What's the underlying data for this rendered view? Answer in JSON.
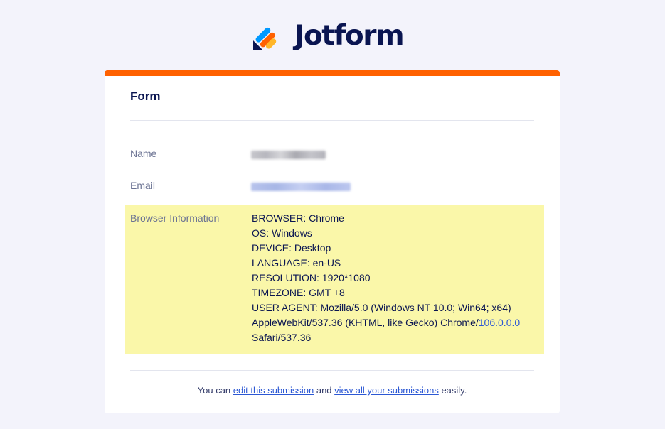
{
  "brand": {
    "name": "Jotform",
    "mark_colors": [
      "#0099ff",
      "#ff6100",
      "#ffb629",
      "#0a1551"
    ]
  },
  "form": {
    "title": "Form",
    "accent_color": "#ff6100",
    "fields": {
      "name_label": "Name",
      "email_label": "Email",
      "browser_label": "Browser Information"
    },
    "browser_info": {
      "browser": "BROWSER: Chrome",
      "os": "OS: Windows",
      "device": "DEVICE: Desktop",
      "language": "LANGUAGE: en-US",
      "resolution": "RESOLUTION: 1920*1080",
      "timezone": "TIMEZONE: GMT +8",
      "user_agent_1": "USER AGENT: Mozilla/5.0 (Windows NT 10.0; Win64; x64)",
      "user_agent_2_prefix": "AppleWebKit/537.36 (KHTML, like Gecko) Chrome/",
      "user_agent_2_link": "106.0.0.0",
      "user_agent_3": "Safari/537.36"
    },
    "highlight_color": "#faf7a9"
  },
  "footer": {
    "prefix": "You can ",
    "edit_link": "edit this submission",
    "middle": " and ",
    "view_link": "view all your submissions",
    "suffix": " easily."
  }
}
